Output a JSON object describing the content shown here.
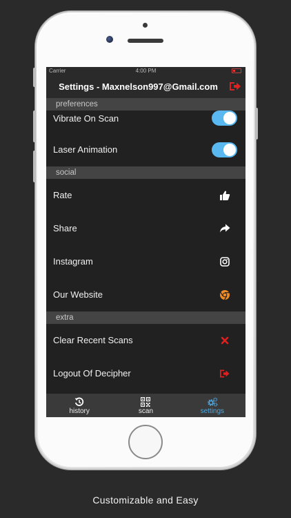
{
  "status_bar": {
    "carrier": "Carrier",
    "time": "4:00 PM"
  },
  "nav": {
    "title": "Settings - Maxnelson997@Gmail.com",
    "logout_icon": "sign-out-icon",
    "logout_color": "#e02020"
  },
  "sections": {
    "preferences": {
      "header": "preferences",
      "items": [
        {
          "label": "Vibrate On Scan",
          "toggle": true
        },
        {
          "label": "Laser Animation",
          "toggle": true
        }
      ]
    },
    "social": {
      "header": "social",
      "items": [
        {
          "label": "Rate",
          "icon": "thumbs-up-icon"
        },
        {
          "label": "Share",
          "icon": "share-arrow-icon"
        },
        {
          "label": "Instagram",
          "icon": "instagram-icon"
        },
        {
          "label": "Our Website",
          "icon": "chrome-icon"
        }
      ]
    },
    "extra": {
      "header": "extra",
      "items": [
        {
          "label": "Clear Recent Scans",
          "icon": "close-icon"
        },
        {
          "label": "Logout Of Decipher",
          "icon": "sign-out-icon"
        }
      ]
    }
  },
  "tabs": [
    {
      "label": "history",
      "icon": "history-icon",
      "active": false
    },
    {
      "label": "scan",
      "icon": "qr-code-icon",
      "active": false
    },
    {
      "label": "settings",
      "icon": "gears-icon",
      "active": true
    }
  ],
  "colors": {
    "toggle_on": "#5ab8f0",
    "tab_active": "#4fa8e0",
    "danger": "#e02020",
    "website": "#f08a24"
  },
  "caption": "Customizable and Easy"
}
